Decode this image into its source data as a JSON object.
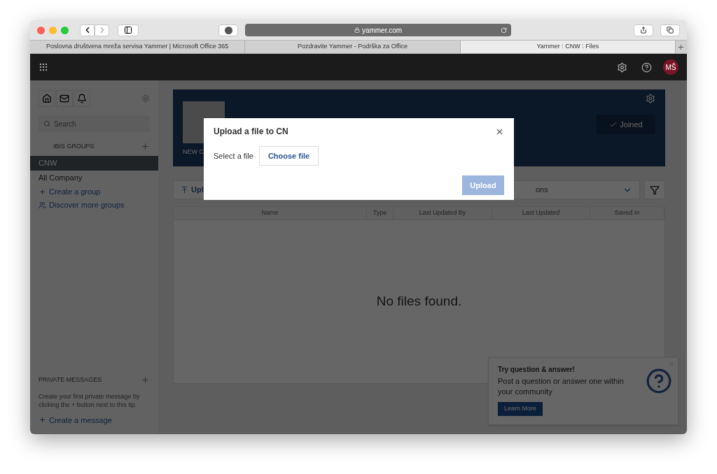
{
  "browser": {
    "address": "yammer.com",
    "tabs": [
      {
        "label": "Poslovna društvena mreža servisa Yammer | Microsoft Office 365",
        "selected": false
      },
      {
        "label": "Pozdravite Yammer - Podrška za Office",
        "selected": false
      },
      {
        "label": "Yammer : CNW : Files",
        "selected": true
      }
    ]
  },
  "header": {
    "avatar": "MŠ"
  },
  "sidebar": {
    "search": {
      "placeholder": "Search"
    },
    "groups_heading": "IBIS GROUPS",
    "groups": [
      {
        "label": "CNW",
        "selected": true
      },
      {
        "label": "All Company",
        "selected": false
      }
    ],
    "links": [
      "Create a group",
      "Discover more groups"
    ],
    "messages_heading": "PRIVATE MESSAGES",
    "messages_tip": "Create your first private message by clicking the + button next to this tip.",
    "messages_link": "Create a message"
  },
  "group_banner": {
    "caption": "NEW C",
    "joined": "Joined"
  },
  "toolbar": {
    "upload": "Upl",
    "dropdown": "ons"
  },
  "table": {
    "columns": [
      "Name",
      "Type",
      "Last Updated By",
      "Last Updated",
      "Saved In"
    ],
    "empty": "No files found."
  },
  "dialog": {
    "title": "Upload a file to CN",
    "label": "Select a file",
    "choose": "Choose file",
    "upload": "Upload",
    "upload_disabled": true
  },
  "tip": {
    "title": "Try question & answer!",
    "body": "Post a question or answer one within your community",
    "button": "Learn More"
  }
}
